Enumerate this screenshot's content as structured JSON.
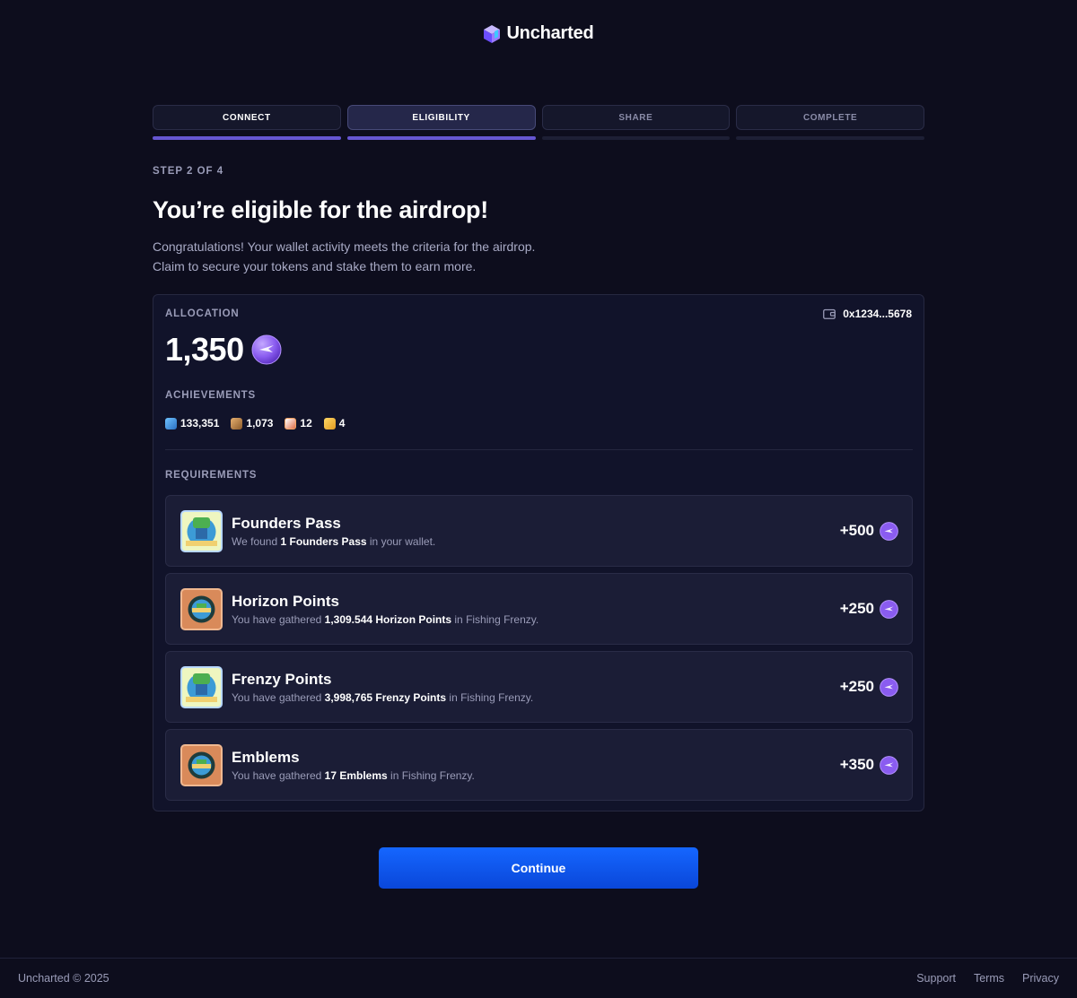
{
  "header": {
    "brand": "Uncharted",
    "logo_icon": "cube-logo-icon"
  },
  "stepper": {
    "steps": [
      {
        "label": "CONNECT",
        "state": "done"
      },
      {
        "label": "ELIGIBILITY",
        "state": "active"
      },
      {
        "label": "SHARE",
        "state": "pending"
      },
      {
        "label": "COMPLETE",
        "state": "pending"
      }
    ]
  },
  "intro": {
    "step_label": "STEP 2 OF 4",
    "title": "You’re eligible for the airdrop!",
    "subtitle_line1": "Congratulations! Your wallet activity meets the criteria for the airdrop.",
    "subtitle_line2": "Claim to secure your tokens and stake them to earn more."
  },
  "card": {
    "allocation_label": "ALLOCATION",
    "allocation_value": "1,350",
    "wallet_address": "0x1234...5678",
    "achievements_label": "ACHIEVEMENTS",
    "achievements": [
      {
        "value": "133,351",
        "icon": "fish-icon",
        "color": "#3a8fd6"
      },
      {
        "value": "1,073",
        "icon": "chest-icon",
        "color": "#c98a4a"
      },
      {
        "value": "12",
        "icon": "card-icon",
        "color": "#e0704a"
      },
      {
        "value": "4",
        "icon": "medal-icon",
        "color": "#f0b430"
      }
    ],
    "requirements_label": "REQUIREMENTS",
    "requirements": [
      {
        "title": "Founders Pass",
        "desc_pre": "We found",
        "desc_bold": "1 Founders Pass",
        "desc_post": "in your wallet.",
        "reward": "+500"
      },
      {
        "title": "Horizon Points",
        "desc_pre": "You have gathered",
        "desc_bold": "1,309.544 Horizon Points",
        "desc_post": "in Fishing Frenzy.",
        "reward": "+250"
      },
      {
        "title": "Frenzy Points",
        "desc_pre": "You have gathered",
        "desc_bold": "3,998,765 Frenzy Points",
        "desc_post": "in Fishing Frenzy.",
        "reward": "+250"
      },
      {
        "title": "Emblems",
        "desc_pre": "You have gathered",
        "desc_bold": "17 Emblems",
        "desc_post": "in Fishing Frenzy.",
        "reward": "+350"
      }
    ]
  },
  "actions": {
    "continue_label": "Continue"
  },
  "footer": {
    "copyright": "Uncharted © 2025",
    "links": [
      "Support",
      "Terms",
      "Privacy"
    ]
  },
  "colors": {
    "accent": "#6656d2",
    "button": "#1566ff",
    "background": "#0d0d1d",
    "token": "#8b5cf6"
  }
}
